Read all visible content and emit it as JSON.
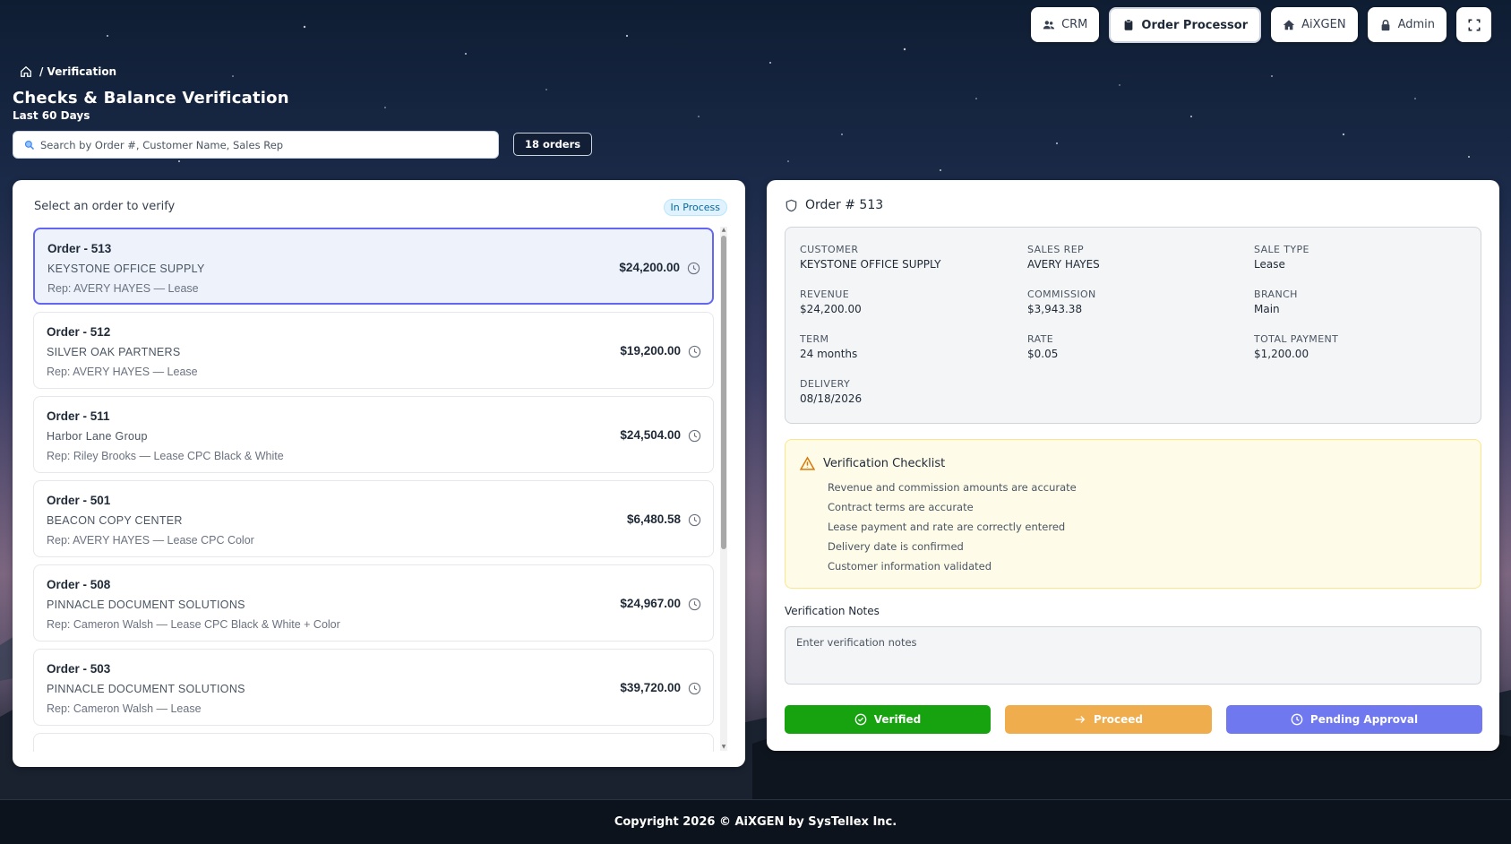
{
  "nav": {
    "crm": "CRM",
    "order_processor": "Order Processor",
    "aixgen": "AiXGEN",
    "admin": "Admin"
  },
  "header": {
    "breadcrumb": "/ Verification",
    "title": "Checks & Balance Verification",
    "subtitle": "Last 60 Days",
    "search_placeholder": "Search by Order #, Customer Name, Sales Rep",
    "order_count": "18 orders"
  },
  "list": {
    "heading": "Select an order to verify",
    "status": "In Process",
    "orders": [
      {
        "title": "Order - 513",
        "customer": "KEYSTONE OFFICE SUPPLY",
        "rep": "Rep: AVERY HAYES — Lease",
        "amount": "$24,200.00"
      },
      {
        "title": "Order - 512",
        "customer": "SILVER OAK PARTNERS",
        "rep": "Rep: AVERY HAYES — Lease",
        "amount": "$19,200.00"
      },
      {
        "title": "Order - 511",
        "customer": "Harbor Lane Group",
        "rep": "Rep: Riley Brooks — Lease CPC Black & White",
        "amount": "$24,504.00"
      },
      {
        "title": "Order - 501",
        "customer": "BEACON COPY CENTER",
        "rep": "Rep: AVERY HAYES — Lease CPC Color",
        "amount": "$6,480.58"
      },
      {
        "title": "Order - 508",
        "customer": "PINNACLE DOCUMENT SOLUTIONS",
        "rep": "Rep: Cameron Walsh — Lease CPC Black & White + Color",
        "amount": "$24,967.00"
      },
      {
        "title": "Order - 503",
        "customer": "PINNACLE DOCUMENT SOLUTIONS",
        "rep": "Rep: Cameron Walsh — Lease",
        "amount": "$39,720.00"
      }
    ]
  },
  "detail": {
    "heading": "Order # 513",
    "fields": {
      "customer": {
        "label": "Customer",
        "value": "KEYSTONE OFFICE SUPPLY"
      },
      "sales_rep": {
        "label": "Sales Rep",
        "value": "AVERY HAYES"
      },
      "sale_type": {
        "label": "Sale Type",
        "value": "Lease"
      },
      "revenue": {
        "label": "Revenue",
        "value": "$24,200.00"
      },
      "commission": {
        "label": "Commission",
        "value": "$3,943.38"
      },
      "branch": {
        "label": "Branch",
        "value": "Main"
      },
      "term": {
        "label": "Term",
        "value": "24 months"
      },
      "rate": {
        "label": "Rate",
        "value": "$0.05"
      },
      "total_payment": {
        "label": "Total Payment",
        "value": "$1,200.00"
      },
      "delivery": {
        "label": "Delivery",
        "value": "08/18/2026"
      }
    },
    "checklist": {
      "heading": "Verification Checklist",
      "items": [
        "Revenue and commission amounts are accurate",
        "Contract terms are accurate",
        "Lease payment and rate are correctly entered",
        "Delivery date is confirmed",
        "Customer information validated"
      ]
    },
    "notes": {
      "label": "Verification Notes",
      "placeholder": "Enter verification notes"
    },
    "actions": {
      "verified": "Verified",
      "proceed": "Proceed",
      "pending": "Pending Approval"
    }
  },
  "footer": "Copyright 2026 © AiXGEN by SysTellex Inc.",
  "colors": {
    "accent": "#6366f1",
    "verified": "#16a30f",
    "proceed": "#f0ad4e",
    "pending": "#6f78ef"
  }
}
